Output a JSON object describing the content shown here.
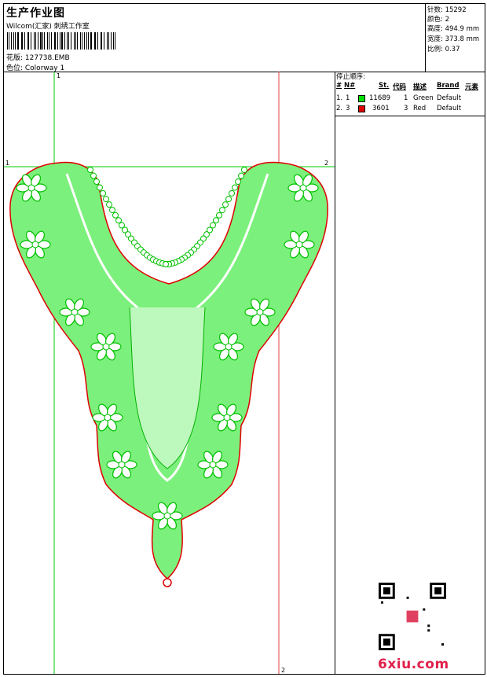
{
  "header": {
    "title": "生产作业图",
    "subtitle": "Wilcom(汇家) 刺绣工作室",
    "design_label": "花版: 127738.EMB",
    "colorway_label": "色位: Colorway 1"
  },
  "stats": {
    "stitches": "针数: 15292",
    "colors": "颜色: 2",
    "height": "高度: 494.9 mm",
    "width": "宽度: 373.8 mm",
    "scale": "比例: 0.37"
  },
  "stop_sequence": {
    "heading": "停止顺序:",
    "headers": [
      "#",
      "N#",
      "St.",
      "代码",
      "描述",
      "Brand",
      "元素"
    ],
    "rows": [
      {
        "index": "1.",
        "n": "1",
        "stitches": "11689",
        "code": "1",
        "desc": "Green",
        "brand": "Default",
        "color": "#00e000"
      },
      {
        "index": "2.",
        "n": "3",
        "stitches": "3601",
        "code": "3",
        "desc": "Red",
        "brand": "Default",
        "color": "#e00000"
      }
    ]
  },
  "canvas": {
    "marker_top_1": "1",
    "marker_left_1": "1",
    "marker_right_2": "2",
    "marker_bottom_2": "2",
    "guide_color": "#00cc00",
    "outline_color": "#e00000",
    "fill_color": "#22ee22"
  },
  "footer": {
    "site": "6xiu.com"
  }
}
